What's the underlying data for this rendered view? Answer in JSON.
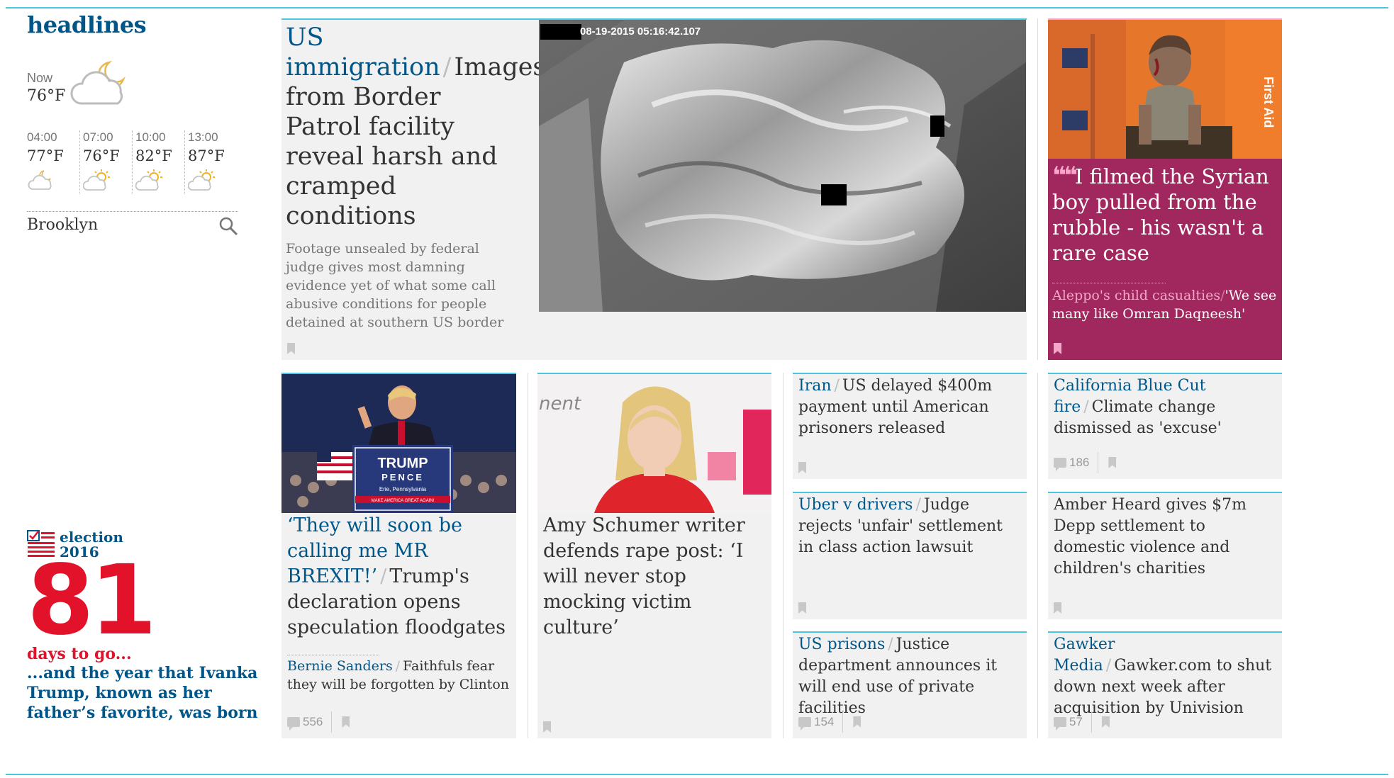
{
  "section": {
    "title": "headlines"
  },
  "weather": {
    "now_label": "Now",
    "now_temp": "76°F",
    "now_icon": "moon-cloud-icon",
    "forecast": [
      {
        "time": "04:00",
        "temp": "77°F",
        "icon": "moon-cloud-icon"
      },
      {
        "time": "07:00",
        "temp": "76°F",
        "icon": "sun-cloud-icon"
      },
      {
        "time": "10:00",
        "temp": "82°F",
        "icon": "sun-cloud-icon"
      },
      {
        "time": "13:00",
        "temp": "87°F",
        "icon": "sun-cloud-icon"
      }
    ],
    "location": "Brooklyn"
  },
  "election": {
    "label_line1": "election",
    "label_line2": "2016",
    "number": "81",
    "days_to_go": "days to go...",
    "fact": "...and the year that Ivanka Trump, known as her father’s favorite, was born"
  },
  "feature": {
    "kicker": "US immigration",
    "headline": "Images from Border Patrol facility reveal harsh and cramped conditions",
    "standfirst": "Footage unsealed by federal judge gives most damning evidence yet of what some call abusive conditions for people detained at southern US border",
    "image_timestamp": "08-19-2015 05:16:42.107"
  },
  "opinion": {
    "headline": "I filmed the Syrian boy pulled from the rubble - his wasn't a rare case",
    "sub_kicker": "Aleppo's child casualties",
    "sub_text": "'We see many like Omran Daqneesh'",
    "ambulance_text": "First Aid"
  },
  "cards": {
    "trump": {
      "kicker": "‘They will soon be calling me MR BREXIT!’",
      "headline": "Trump's declaration opens speculation floodgates",
      "sub_kicker": "Bernie Sanders",
      "sub_text": "Faithfuls fear they will be forgotten by Clinton",
      "comments": "556",
      "sign_line1": "TRUMP",
      "sign_line2": "PENCE",
      "sign_line3": "Erie, Pennsylvania",
      "sign_line4": "MAKE AMERICA GREAT AGAIN!"
    },
    "schumer": {
      "headline": "Amy Schumer writer defends rape post: ‘I will never stop mocking victim culture’"
    },
    "iran": {
      "kicker": "Iran",
      "headline": "US delayed $400m payment until American prisoners released"
    },
    "uber": {
      "kicker": "Uber v drivers",
      "headline": "Judge rejects 'unfair' settlement in class action lawsuit"
    },
    "prisons": {
      "kicker": "US prisons",
      "headline": "Justice department announces it will end use of private facilities",
      "comments": "154"
    },
    "california": {
      "kicker": "California Blue Cut fire",
      "headline": "Climate change dismissed as 'excuse'",
      "comments": "186"
    },
    "heard": {
      "headline": "Amber Heard gives $7m Depp settlement to domestic violence and children's charities"
    },
    "gawker": {
      "kicker": "Gawker Media",
      "headline": "Gawker.com to shut down next week after acquisition by Univision",
      "comments": "57"
    }
  },
  "colors": {
    "accent": "#4bc6df",
    "brand_blue": "#005689",
    "election_red": "#e2122a",
    "opinion_bg": "#a1285e",
    "opinion_pink": "#f6a6c8",
    "card_bg": "#f1f1f1"
  }
}
